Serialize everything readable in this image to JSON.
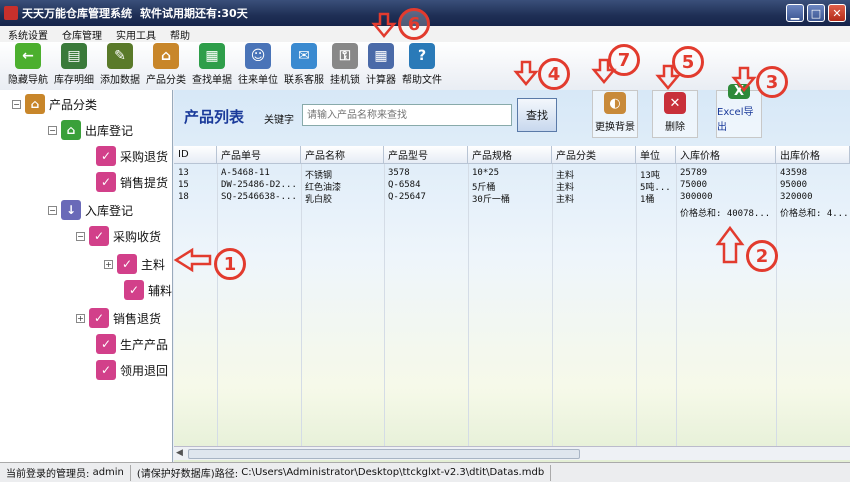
{
  "window": {
    "title": "天天万能仓库管理系统",
    "trial_notice": "软件试用期还有:30天"
  },
  "menu": [
    "系统设置",
    "仓库管理",
    "实用工具",
    "帮助"
  ],
  "toolbar": [
    {
      "label": "隐藏导航",
      "icon": "arrow-left-icon",
      "color": "#4caf2e"
    },
    {
      "label": "库存明细",
      "icon": "notebook-icon",
      "color": "#3a7a3a"
    },
    {
      "label": "添加数据",
      "icon": "edit-icon",
      "color": "#5a7a2a"
    },
    {
      "label": "产品分类",
      "icon": "house-icon",
      "color": "#c8862a"
    },
    {
      "label": "查找单据",
      "icon": "book-icon",
      "color": "#2e9e4a"
    },
    {
      "label": "往来单位",
      "icon": "users-icon",
      "color": "#4a74b8"
    },
    {
      "label": "联系客服",
      "icon": "chat-icon",
      "color": "#3a8ad0"
    },
    {
      "label": "挂机锁",
      "icon": "keys-icon",
      "color": "#888888"
    },
    {
      "label": "计算器",
      "icon": "calculator-icon",
      "color": "#4a6aa8"
    },
    {
      "label": "帮助文件",
      "icon": "help-icon",
      "color": "#2a7ab8"
    }
  ],
  "tree": [
    {
      "label": "产品分类",
      "icon": "house-icon",
      "level": 0
    },
    {
      "label": "出库登记",
      "icon": "house-green-icon",
      "level": 1
    },
    {
      "label": "采购退货",
      "icon": "leaf-icon",
      "level": 2
    },
    {
      "label": "销售提货",
      "icon": "leaf-icon",
      "level": 2
    },
    {
      "label": "入库登记",
      "icon": "download-icon",
      "level": 1
    },
    {
      "label": "采购收货",
      "icon": "leaf-icon",
      "level": 2
    },
    {
      "label": "主料",
      "icon": "leaf-icon",
      "level": 3
    },
    {
      "label": "辅料",
      "icon": "leaf-icon",
      "level": 3
    },
    {
      "label": "销售退货",
      "icon": "leaf-icon",
      "level": 2
    },
    {
      "label": "生产产品",
      "icon": "leaf-icon",
      "level": 2
    },
    {
      "label": "领用退回",
      "icon": "leaf-icon",
      "level": 2
    }
  ],
  "main": {
    "title": "产品列表",
    "keyword_label": "关键字",
    "search_placeholder": "请输入产品名称来查找",
    "search_button": "查找",
    "change_bg_button": "更换背景",
    "delete_button": "删除",
    "excel_button": "Excel导出"
  },
  "table": {
    "columns": [
      "ID",
      "产品单号",
      "产品名称",
      "产品型号",
      "产品规格",
      "产品分类",
      "单位",
      "入库价格",
      "出库价格"
    ],
    "rows": [
      [
        "13",
        "A-5468-11",
        "不锈钢",
        "3578",
        "10*25",
        "主料",
        "13吨",
        "25789",
        "43598"
      ],
      [
        "15",
        "DW-25486-D2...",
        "红色油漆",
        "Q-6584",
        "5斤桶",
        "主料",
        "5吨...",
        "75000",
        "95000"
      ],
      [
        "18",
        "SQ-2546638-...",
        "乳白胶",
        "Q-25647",
        "30斤一桶",
        "主料",
        "1桶",
        "300000",
        "320000"
      ]
    ],
    "summary_in": "价格总和: 40078...",
    "summary_out": "价格总和: 4..."
  },
  "status": {
    "admin_label": "当前登录的管理员:",
    "admin_name": "admin",
    "path_label": "(请保护好数据库)路径:",
    "path": "C:\\Users\\Administrator\\Desktop\\ttckglxt-v2.3\\dtit\\Datas.mdb"
  },
  "annotations": [
    "1",
    "2",
    "3",
    "4",
    "5",
    "6",
    "7"
  ],
  "colors": {
    "accent": "#1a3a9a",
    "annotation": "#e23b2e",
    "titlebar": "#1f2f55"
  }
}
